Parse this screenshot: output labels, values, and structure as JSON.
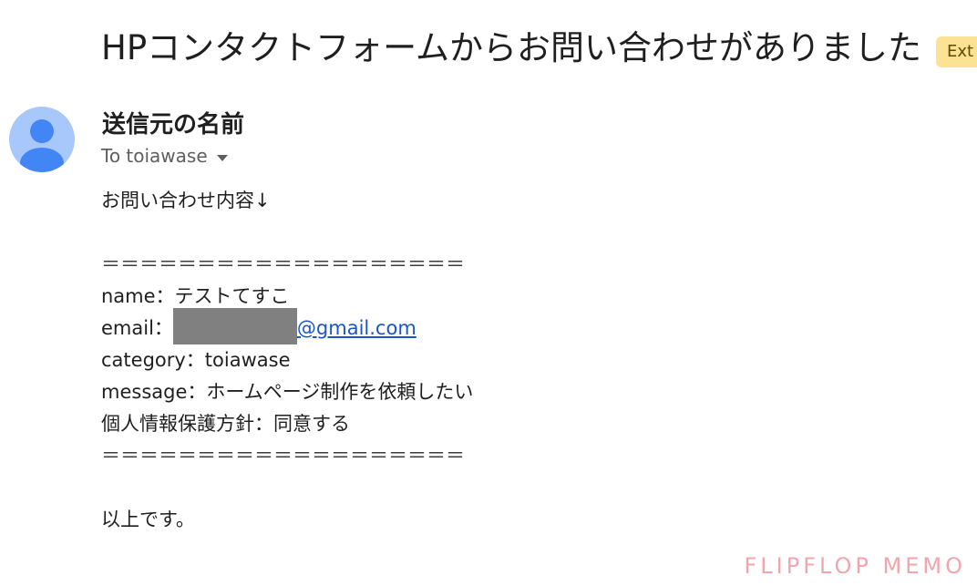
{
  "email": {
    "subject": "HPコンタクトフォームからお問い合わせがありました",
    "label_badge": "Ext",
    "sender_name": "送信元の名前",
    "recipient_line": "To toiawase",
    "body": {
      "intro": "お問い合わせ内容↓",
      "separator": "＝＝＝＝＝＝＝＝＝＝＝＝＝＝＝＝＝＝＝",
      "name_line": "name：テストてすこ",
      "email_label": "email：",
      "email_domain": "@gmail.com",
      "category_line": "category：toiawase",
      "message_line": "message：ホームページ制作を依頼したい",
      "privacy_line": "個人情報保護方針：同意する",
      "closing": "以上です。"
    }
  },
  "watermark": "FLIPFLOP MEMO",
  "colors": {
    "avatar_bg": "#a8c7fa",
    "avatar_figure": "#4285f4",
    "badge_bg": "#fde293",
    "link": "#1a56c9",
    "redaction": "#808080",
    "watermark": "#f2a5ad"
  }
}
